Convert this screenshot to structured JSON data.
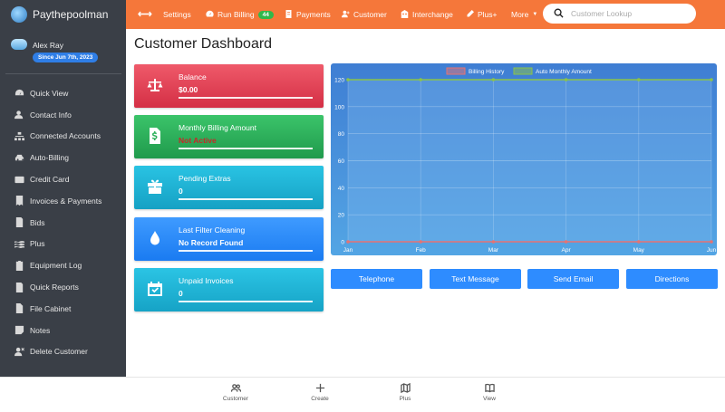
{
  "app": {
    "name": "Paythepoolman"
  },
  "user": {
    "name": "Alex Ray",
    "since": "Since Jun 7th, 2023"
  },
  "sidebar": {
    "items": [
      {
        "label": "Quick View",
        "icon": "dashboard-icon"
      },
      {
        "label": "Contact Info",
        "icon": "contact-icon"
      },
      {
        "label": "Connected Accounts",
        "icon": "sitemap-icon"
      },
      {
        "label": "Auto-Billing",
        "icon": "car-icon"
      },
      {
        "label": "Credit Card",
        "icon": "credit-card-icon"
      },
      {
        "label": "Invoices & Payments",
        "icon": "invoice-icon"
      },
      {
        "label": "Bids",
        "icon": "document-icon"
      },
      {
        "label": "Plus",
        "icon": "water-icon"
      },
      {
        "label": "Equipment Log",
        "icon": "clipboard-icon"
      },
      {
        "label": "Quick Reports",
        "icon": "report-icon"
      },
      {
        "label": "File Cabinet",
        "icon": "file-icon"
      },
      {
        "label": "Notes",
        "icon": "note-icon"
      },
      {
        "label": "Delete Customer",
        "icon": "user-delete-icon"
      }
    ]
  },
  "topbar": {
    "settings": "Settings",
    "run_billing": "Run Billing",
    "run_billing_badge": "44",
    "payments": "Payments",
    "customer": "Customer",
    "interchange": "Interchange",
    "plus": "Plus+",
    "more": "More",
    "search_placeholder": "Customer Lookup"
  },
  "main": {
    "title": "Customer Dashboard",
    "cards": [
      {
        "label": "Balance",
        "value": "$0.00"
      },
      {
        "label": "Monthly Billing Amount",
        "value": "Not Active"
      },
      {
        "label": "Pending Extras",
        "value": "0"
      },
      {
        "label": "Last Filter Cleaning",
        "value": "No Record Found"
      },
      {
        "label": "Unpaid Invoices",
        "value": "0"
      }
    ],
    "actions": [
      "Telephone",
      "Text Message",
      "Send Email",
      "Directions"
    ]
  },
  "chart_data": {
    "type": "line",
    "categories": [
      "Jan",
      "Feb",
      "Mar",
      "Apr",
      "May",
      "Jun"
    ],
    "series": [
      {
        "name": "Billing History",
        "values": [
          0,
          0,
          0,
          0,
          0,
          0
        ],
        "color": "#e57373"
      },
      {
        "name": "Auto Monthly Amount",
        "values": [
          120,
          120,
          120,
          120,
          120,
          120
        ],
        "color": "#8bc34a"
      }
    ],
    "ylim": [
      0,
      120
    ],
    "yticks": [
      "0",
      "20",
      "40",
      "60",
      "80",
      "100",
      "120"
    ],
    "legend": "top-center",
    "grid": true
  },
  "bottom": {
    "items": [
      {
        "label": "Customer",
        "icon": "users-icon"
      },
      {
        "label": "Create",
        "icon": "plus-icon"
      },
      {
        "label": "Plus",
        "icon": "map-icon"
      },
      {
        "label": "View",
        "icon": "book-icon"
      }
    ]
  },
  "colors": {
    "topbar": "#f5773a",
    "sidebar": "#3a3f47",
    "action": "#2e8cff"
  }
}
